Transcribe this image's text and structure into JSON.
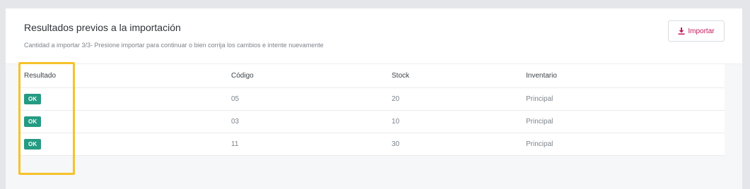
{
  "header": {
    "title": "Resultados previos a la importación",
    "subtitle": "Cantidad a importar 3/3- Presione importar para continuar o bien corrija los cambios e intente nuevamente",
    "import_button": {
      "label": "Importar",
      "icon": "download-icon"
    }
  },
  "colors": {
    "accent": "#c2185b",
    "ok_badge": "#269b84",
    "highlight": "#f6c22a"
  },
  "table": {
    "columns": [
      "Resultado",
      "Código",
      "Stock",
      "Inventario"
    ],
    "rows": [
      {
        "resultado": "OK",
        "codigo": "05",
        "stock": "20",
        "inventario": "Principal"
      },
      {
        "resultado": "OK",
        "codigo": "03",
        "stock": "10",
        "inventario": "Principal"
      },
      {
        "resultado": "OK",
        "codigo": "11",
        "stock": "30",
        "inventario": "Principal"
      }
    ]
  }
}
